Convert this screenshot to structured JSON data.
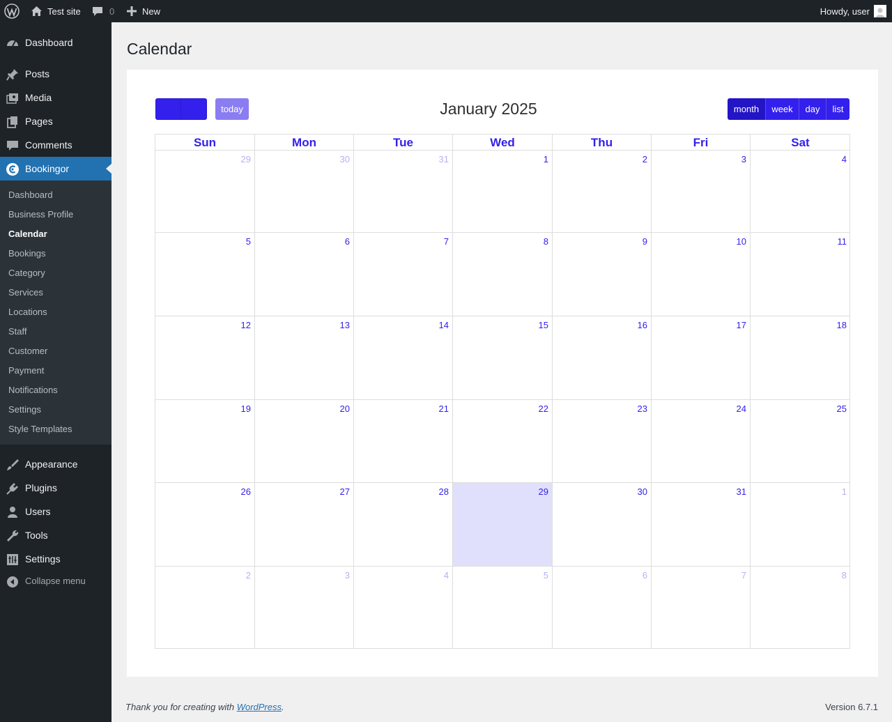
{
  "adminbar": {
    "site_name": "Test site",
    "comments_count": "0",
    "new_label": "New",
    "greeting": "Howdy, user"
  },
  "sidebar": {
    "top_items": [
      {
        "label": "Dashboard",
        "icon": "dashboard-icon"
      },
      {
        "label": "Posts",
        "icon": "pin-icon"
      },
      {
        "label": "Media",
        "icon": "media-icon"
      },
      {
        "label": "Pages",
        "icon": "pages-icon"
      },
      {
        "label": "Comments",
        "icon": "comment-icon"
      },
      {
        "label": "Bookingor",
        "icon": "bookingor-icon"
      }
    ],
    "submenu": [
      "Dashboard",
      "Business Profile",
      "Calendar",
      "Bookings",
      "Category",
      "Services",
      "Locations",
      "Staff",
      "Customer",
      "Payment",
      "Notifications",
      "Settings",
      "Style Templates"
    ],
    "submenu_current": "Calendar",
    "bottom_items": [
      {
        "label": "Appearance",
        "icon": "brush-icon"
      },
      {
        "label": "Plugins",
        "icon": "plug-icon"
      },
      {
        "label": "Users",
        "icon": "users-icon"
      },
      {
        "label": "Tools",
        "icon": "wrench-icon"
      },
      {
        "label": "Settings",
        "icon": "sliders-icon"
      }
    ],
    "collapse_label": "Collapse menu"
  },
  "page": {
    "title": "Calendar"
  },
  "calendar": {
    "title": "January 2025",
    "today_label": "today",
    "views": [
      "month",
      "week",
      "day",
      "list"
    ],
    "active_view": "month",
    "weekdays": [
      "Sun",
      "Mon",
      "Tue",
      "Wed",
      "Thu",
      "Fri",
      "Sat"
    ],
    "weeks": [
      [
        {
          "d": "29",
          "other": true
        },
        {
          "d": "30",
          "other": true
        },
        {
          "d": "31",
          "other": true
        },
        {
          "d": "1"
        },
        {
          "d": "2"
        },
        {
          "d": "3"
        },
        {
          "d": "4"
        }
      ],
      [
        {
          "d": "5"
        },
        {
          "d": "6"
        },
        {
          "d": "7"
        },
        {
          "d": "8"
        },
        {
          "d": "9"
        },
        {
          "d": "10"
        },
        {
          "d": "11"
        }
      ],
      [
        {
          "d": "12"
        },
        {
          "d": "13"
        },
        {
          "d": "14"
        },
        {
          "d": "15"
        },
        {
          "d": "16"
        },
        {
          "d": "17"
        },
        {
          "d": "18"
        }
      ],
      [
        {
          "d": "19"
        },
        {
          "d": "20"
        },
        {
          "d": "21"
        },
        {
          "d": "22"
        },
        {
          "d": "23"
        },
        {
          "d": "24"
        },
        {
          "d": "25"
        }
      ],
      [
        {
          "d": "26"
        },
        {
          "d": "27"
        },
        {
          "d": "28"
        },
        {
          "d": "29",
          "today": true
        },
        {
          "d": "30"
        },
        {
          "d": "31"
        },
        {
          "d": "1",
          "other": true
        }
      ],
      [
        {
          "d": "2",
          "other": true
        },
        {
          "d": "3",
          "other": true
        },
        {
          "d": "4",
          "other": true
        },
        {
          "d": "5",
          "other": true
        },
        {
          "d": "6",
          "other": true
        },
        {
          "d": "7",
          "other": true
        },
        {
          "d": "8",
          "other": true
        }
      ]
    ]
  },
  "footer": {
    "thanks_prefix": "Thank you for creating with ",
    "thanks_link": "WordPress",
    "thanks_suffix": ".",
    "version": "Version 6.7.1"
  },
  "colors": {
    "accent": "#3320ec",
    "admin_bg": "#1d2327",
    "menu_current": "#2271b1",
    "today_bg": "#e0e0fc"
  }
}
